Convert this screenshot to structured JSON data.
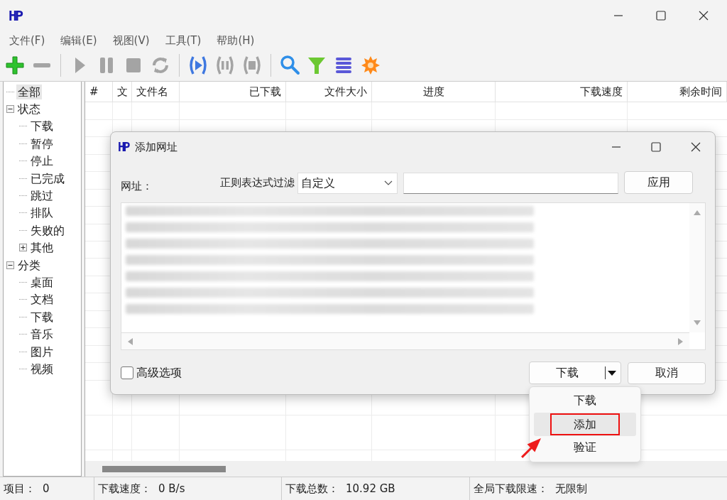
{
  "window": {
    "logo": "HP"
  },
  "menu": [
    "文件(F)",
    "编辑(E)",
    "视图(V)",
    "工具(T)",
    "帮助(H)"
  ],
  "toolbar": [
    [
      {
        "kind": "add",
        "disabled": false
      },
      {
        "kind": "remove",
        "disabled": true
      }
    ],
    [
      {
        "kind": "start",
        "disabled": true
      },
      {
        "kind": "pause",
        "disabled": true
      },
      {
        "kind": "stop",
        "disabled": true
      },
      {
        "kind": "refresh",
        "disabled": true
      }
    ],
    [
      {
        "kind": "start-all",
        "disabled": false
      },
      {
        "kind": "pause-all",
        "disabled": true
      },
      {
        "kind": "stop-all",
        "disabled": true
      }
    ],
    [
      {
        "kind": "search",
        "disabled": false
      },
      {
        "kind": "filter",
        "disabled": false
      },
      {
        "kind": "list",
        "disabled": false
      },
      {
        "kind": "settings",
        "disabled": false
      }
    ]
  ],
  "sidebar": {
    "tree": [
      {
        "label": "全部",
        "selected": true
      },
      {
        "label": "状态",
        "selected": false,
        "expanded": true,
        "children": [
          {
            "label": "下载",
            "selected": false
          },
          {
            "label": "暂停",
            "selected": false
          },
          {
            "label": "停止",
            "selected": false
          },
          {
            "label": "已完成",
            "selected": false
          },
          {
            "label": "跳过",
            "selected": false
          },
          {
            "label": "排队",
            "selected": false
          },
          {
            "label": "失败的",
            "selected": false
          },
          {
            "label": "其他",
            "selected": false,
            "expanded": false
          }
        ]
      },
      {
        "label": "分类",
        "selected": false,
        "expanded": true,
        "children": [
          {
            "label": "桌面",
            "selected": false
          },
          {
            "label": "文档",
            "selected": false
          },
          {
            "label": "下载",
            "selected": false
          },
          {
            "label": "音乐",
            "selected": false
          },
          {
            "label": "图片",
            "selected": false
          },
          {
            "label": "视频",
            "selected": false
          }
        ]
      }
    ]
  },
  "table": {
    "columns": [
      "#",
      "文",
      "文件名",
      "已下载",
      "文件大小",
      "进度",
      "下载速度",
      "剩余时间"
    ]
  },
  "dialog": {
    "logo": "HP",
    "title": "添加网址",
    "url_label": "网址：",
    "filter_label": "正则表达式过滤",
    "filter_select": "自定义",
    "apply": "应用",
    "advanced": {
      "label": "高级选项",
      "checked": false
    },
    "primary": "下载",
    "cancel": "取消"
  },
  "dropdown": [
    {
      "label": "下载",
      "selected": false
    },
    {
      "label": "添加",
      "selected": true
    },
    {
      "label": "验证",
      "selected": false
    }
  ],
  "status_bar": [
    {
      "label": "项目：",
      "value": "0"
    },
    {
      "label": "下载速度：",
      "value": "0 B/s"
    },
    {
      "label": "下载总数：",
      "value": "10.92 GB"
    },
    {
      "label": "全局下载限速：",
      "value": "无限制"
    }
  ]
}
